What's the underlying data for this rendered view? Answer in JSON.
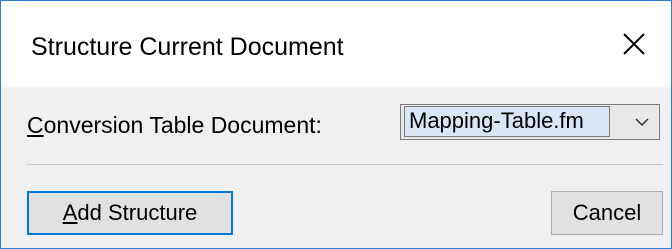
{
  "dialog": {
    "title": "Structure Current Document",
    "close_icon": "close-icon"
  },
  "conversion_table": {
    "label_mnemonic": "C",
    "label_rest": "onversion Table Document:",
    "selected_value": "Mapping-Table.fm",
    "dropdown_icon": "chevron-down-icon"
  },
  "buttons": {
    "add_mnemonic": "A",
    "add_rest": "dd Structure",
    "cancel": "Cancel"
  },
  "colors": {
    "accent": "#0078d7",
    "window_border": "#2b7cd3",
    "dialog_bg": "#f0f0f0",
    "selection_bg": "#d9e6f5"
  }
}
